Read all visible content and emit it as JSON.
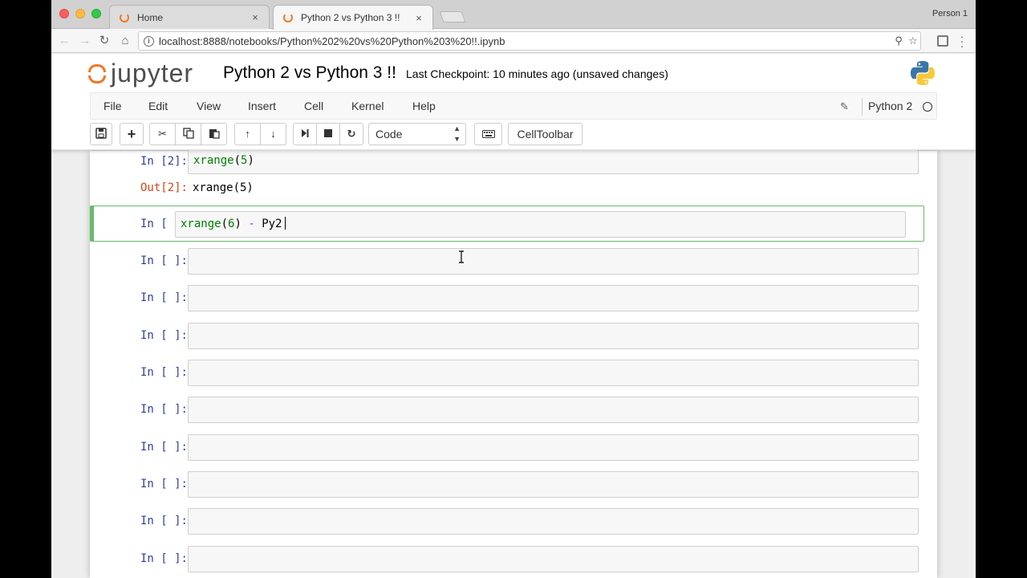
{
  "browser": {
    "tabs": [
      {
        "label": "Home",
        "close": "×"
      },
      {
        "label": "Python 2 vs Python 3 !!",
        "close": "×"
      }
    ],
    "profile": "Person 1",
    "url": "localhost:8888/notebooks/Python%202%20vs%20Python%203%20!!.ipynb"
  },
  "header": {
    "logo_text": "jupyter",
    "notebook_title": "Python 2 vs Python 3 !!",
    "checkpoint": "Last Checkpoint: 10 minutes ago (unsaved changes)"
  },
  "menu": {
    "items": [
      "File",
      "Edit",
      "View",
      "Insert",
      "Cell",
      "Kernel",
      "Help"
    ],
    "kernel_name": "Python 2"
  },
  "toolbar": {
    "cell_type": "Code",
    "celltoolbar_label": "CellToolbar"
  },
  "cells": {
    "c1_prompt": "In [2]:",
    "c1_code_fn": "xrange",
    "c1_code_open": "(",
    "c1_code_num": "5",
    "c1_code_close": ")",
    "c1_out_prompt": "Out[2]:",
    "c1_output": "xrange(5)",
    "c2_prompt": "In [ ]:",
    "c2_code_fn": "xrange",
    "c2_code_open": "(",
    "c2_code_num": "6",
    "c2_code_close": ")",
    "c2_code_op": " - ",
    "c2_code_rest": "Py2",
    "empty_prompt": "In [ ]:"
  }
}
